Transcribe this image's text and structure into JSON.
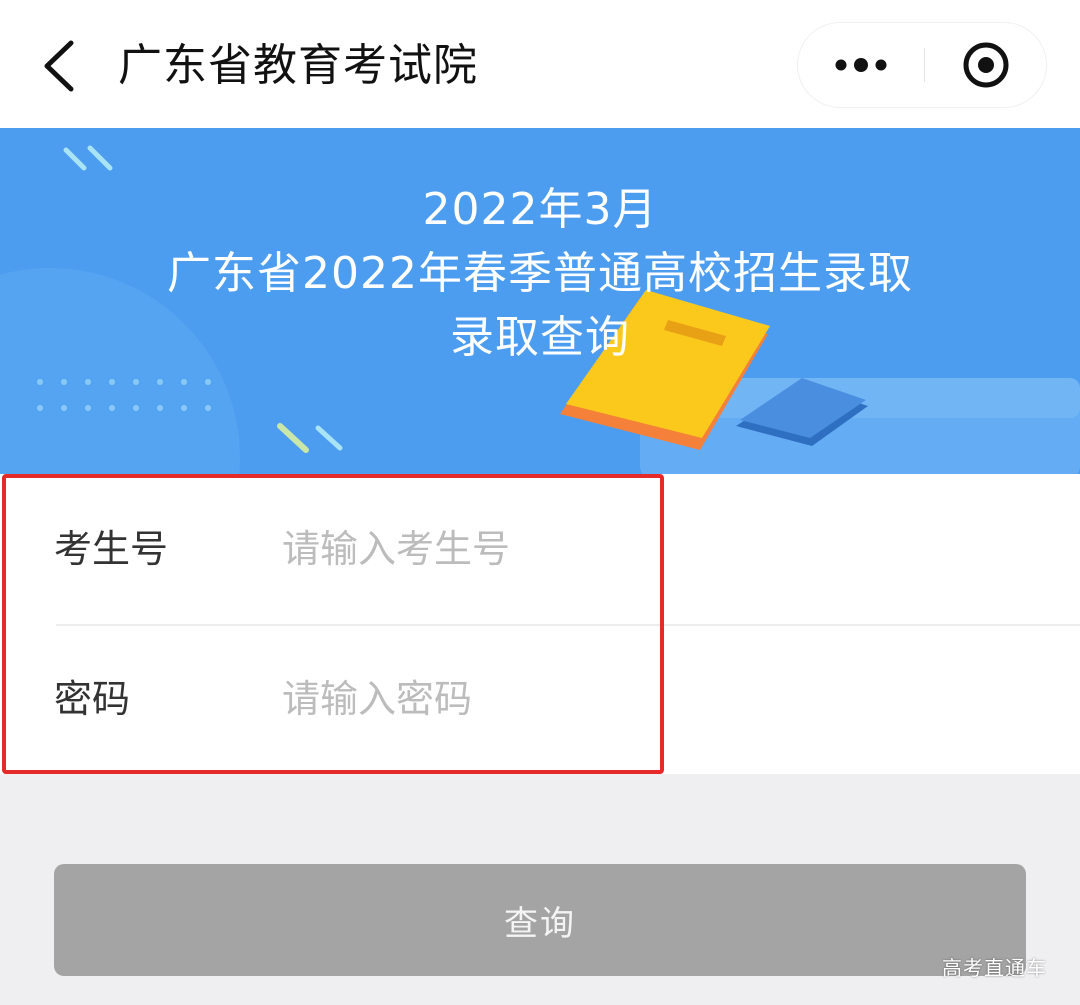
{
  "navbar": {
    "title": "广东省教育考试院",
    "back_icon": "chevron-left-icon",
    "more_icon": "more-dots-icon",
    "close_icon": "target-circle-icon"
  },
  "banner": {
    "line1": "2022年3月",
    "line2": "广东省2022年春季普通高校招生录取",
    "line3": "录取查询",
    "illustration": "books-illustration"
  },
  "form": {
    "exam_no": {
      "label": "考生号",
      "placeholder": "请输入考生号",
      "value": ""
    },
    "password": {
      "label": "密码",
      "placeholder": "请输入密码",
      "value": ""
    }
  },
  "submit": {
    "label": "查询"
  },
  "watermark": "高考直通车",
  "colors": {
    "banner_blue": "#4c9df0",
    "highlight_red": "#e52a2a",
    "button_gray": "#a4a4a4",
    "page_bg": "#efeff1"
  }
}
